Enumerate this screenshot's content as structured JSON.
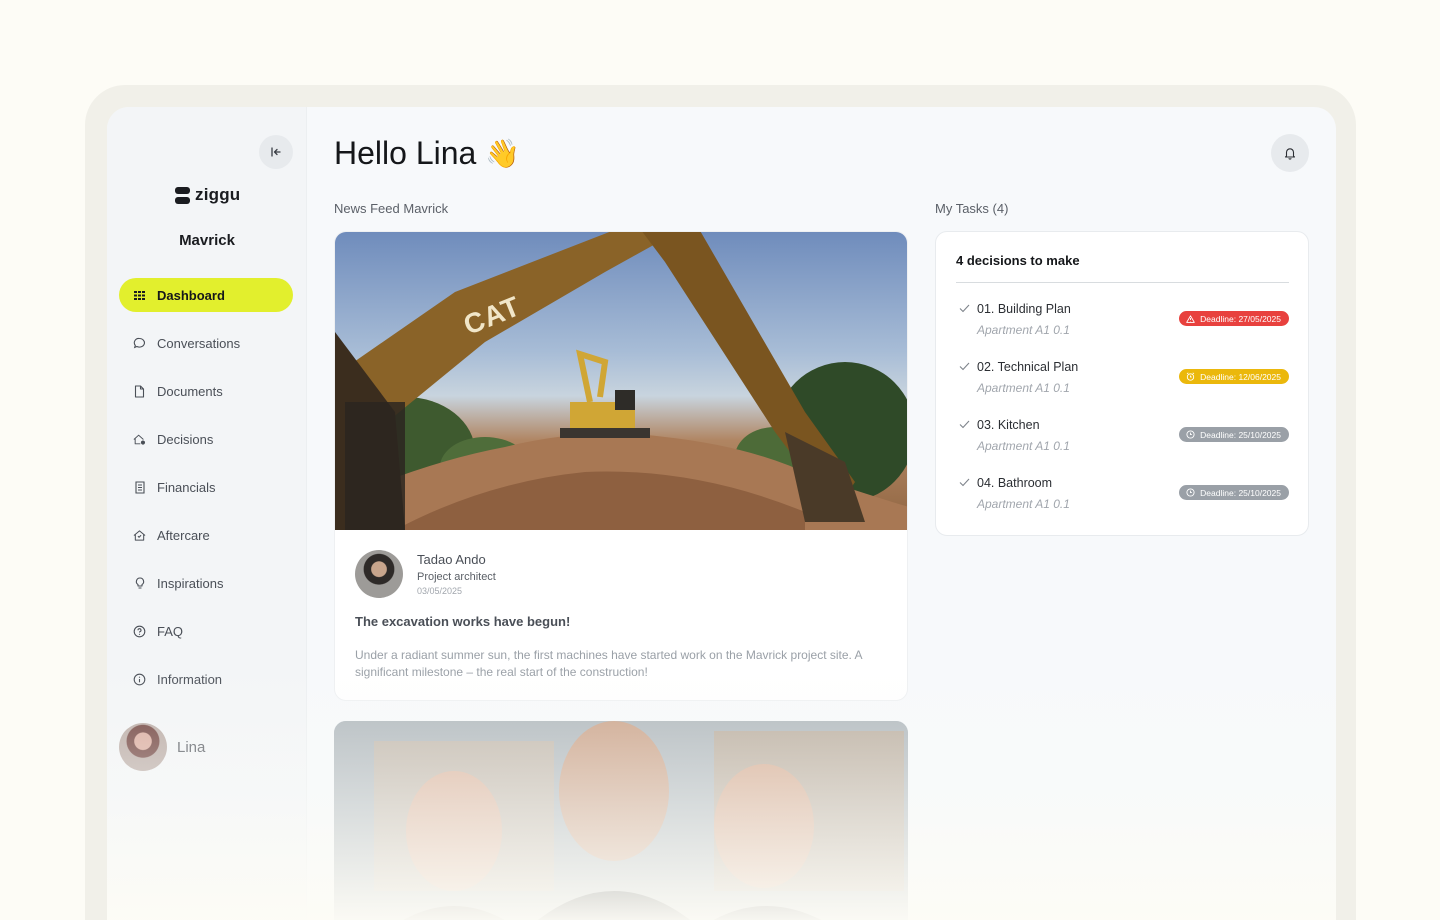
{
  "sidebar": {
    "logo_text": "ziggu",
    "project_name": "Mavrick",
    "items": [
      {
        "label": "Dashboard",
        "icon": "grid-icon",
        "active": true
      },
      {
        "label": "Conversations",
        "icon": "chat-bubble-icon"
      },
      {
        "label": "Documents",
        "icon": "document-icon"
      },
      {
        "label": "Decisions",
        "icon": "home-decision-icon"
      },
      {
        "label": "Financials",
        "icon": "receipt-icon"
      },
      {
        "label": "Aftercare",
        "icon": "home-shield-icon"
      },
      {
        "label": "Inspirations",
        "icon": "lightbulb-icon"
      },
      {
        "label": "FAQ",
        "icon": "question-circle-icon"
      },
      {
        "label": "Information",
        "icon": "info-circle-icon"
      }
    ],
    "user_name": "Lina"
  },
  "header": {
    "greeting": "Hello Lina",
    "emoji": "👋"
  },
  "news": {
    "section_label": "News Feed Mavrick",
    "posts": [
      {
        "author_name": "Tadao Ando",
        "author_role": "Project architect",
        "date": "03/05/2025",
        "title": "The excavation works have begun!",
        "text": "Under a radiant summer sun, the first machines have started work on the Mavrick project site. A significant milestone – the real start of the construction!",
        "image_text": "CAT"
      }
    ]
  },
  "tasks": {
    "section_label": "My Tasks (4)",
    "card_title": "4 decisions to make",
    "items": [
      {
        "name": "01. Building Plan",
        "sub": "Apartment A1 0.1",
        "deadline": "Deadline: 27/05/2025",
        "status": "overdue",
        "color": "#e8413e",
        "icon": "warning-triangle-icon"
      },
      {
        "name": "02. Technical Plan",
        "sub": "Apartment A1 0.1",
        "deadline": "Deadline: 12/06/2025",
        "status": "soon",
        "color": "#ebb80c",
        "icon": "alarm-clock-icon"
      },
      {
        "name": "03. Kitchen",
        "sub": "Apartment A1 0.1",
        "deadline": "Deadline: 25/10/2025",
        "status": "later",
        "color": "#9aa0a7",
        "icon": "clock-icon"
      },
      {
        "name": "04. Bathroom",
        "sub": "Apartment A1 0.1",
        "deadline": "Deadline: 25/10/2025",
        "status": "later",
        "color": "#9aa0a7",
        "icon": "clock-icon"
      }
    ]
  },
  "colors": {
    "accent": "#e2ef2d",
    "page_background": "#fdfcf6",
    "overdue": "#e8413e",
    "soon": "#ebb80c",
    "later": "#9aa0a7"
  }
}
